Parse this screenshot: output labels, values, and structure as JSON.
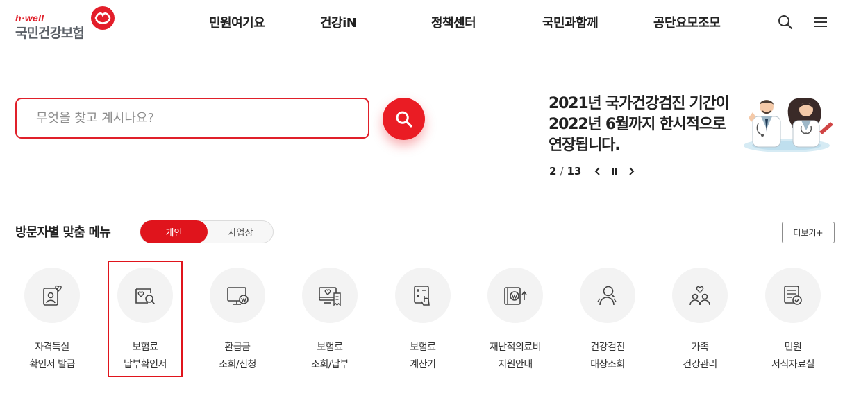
{
  "header": {
    "logo_sub": "h·well",
    "logo_main": "국민건강보험",
    "nav": [
      "민원여기요",
      "건강iN",
      "정책센터",
      "국민과함께",
      "공단요모조모"
    ],
    "icons": [
      "search-icon",
      "hamburger-menu-icon"
    ]
  },
  "search": {
    "placeholder": "무엇을 찾고 계시나요?",
    "value": "",
    "button_icon": "search-icon"
  },
  "banner": {
    "title_lines": [
      "2021년 국가건강검진 기간이",
      "2022년 6월까지 한시적으로",
      "연장됩니다."
    ],
    "current_page": "2",
    "separator": "/",
    "total_pages": "13",
    "controls": [
      "chevron-left-icon",
      "pause-icon",
      "chevron-right-icon"
    ]
  },
  "section": {
    "title": "방문자별 맞춤 메뉴",
    "toggle": [
      "개인",
      "사업장"
    ],
    "toggle_selected": "개인",
    "more_label": "더보기+"
  },
  "menu_items": [
    {
      "line1": "자격득실",
      "line2": "확인서 발급",
      "icon": "id-card-icon"
    },
    {
      "line1": "보험료",
      "line2": "납부확인서",
      "icon": "document-search-icon"
    },
    {
      "line1": "환급금",
      "line2": "조회/신청",
      "icon": "monitor-won-icon"
    },
    {
      "line1": "보험료",
      "line2": "조회/납부",
      "icon": "screen-heart-receipt-icon"
    },
    {
      "line1": "보험료",
      "line2": "계산기",
      "icon": "calculator-touch-icon"
    },
    {
      "line1": "재난적의료비",
      "line2": "지원안내",
      "icon": "wallet-won-up-icon"
    },
    {
      "line1": "건강검진",
      "line2": "대상조회",
      "icon": "person-search-icon"
    },
    {
      "line1": "가족",
      "line2": "건강관리",
      "icon": "family-heart-icon"
    },
    {
      "line1": "민원",
      "line2": "서식자료실",
      "icon": "form-check-icon"
    }
  ],
  "highlighted_item": "보험료 납부확인서",
  "colors": {
    "brand_red": "#e0202a",
    "toggle_red": "#e0141c",
    "logo_gray": "#5a5f66",
    "icon_bg": "#f3f3f3"
  }
}
